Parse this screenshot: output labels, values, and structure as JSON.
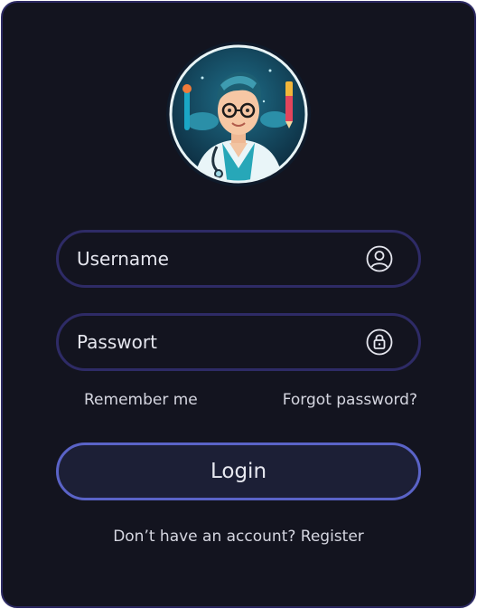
{
  "form": {
    "username_placeholder": "Username",
    "password_placeholder": "Passwort",
    "remember_label": "Remember me",
    "forgot_label": "Forgot password?",
    "login_label": "Login",
    "footer_text": "Don’t have an account? Register"
  },
  "icons": {
    "avatar": "doctor-avatar-illustration",
    "username": "user-circle-icon",
    "password": "lock-circle-icon"
  },
  "colors": {
    "background": "#13141f",
    "field_border": "#2e2b66",
    "button_border": "#5a63c7",
    "button_fill": "#1c1f36",
    "text": "#e5e6ee"
  }
}
